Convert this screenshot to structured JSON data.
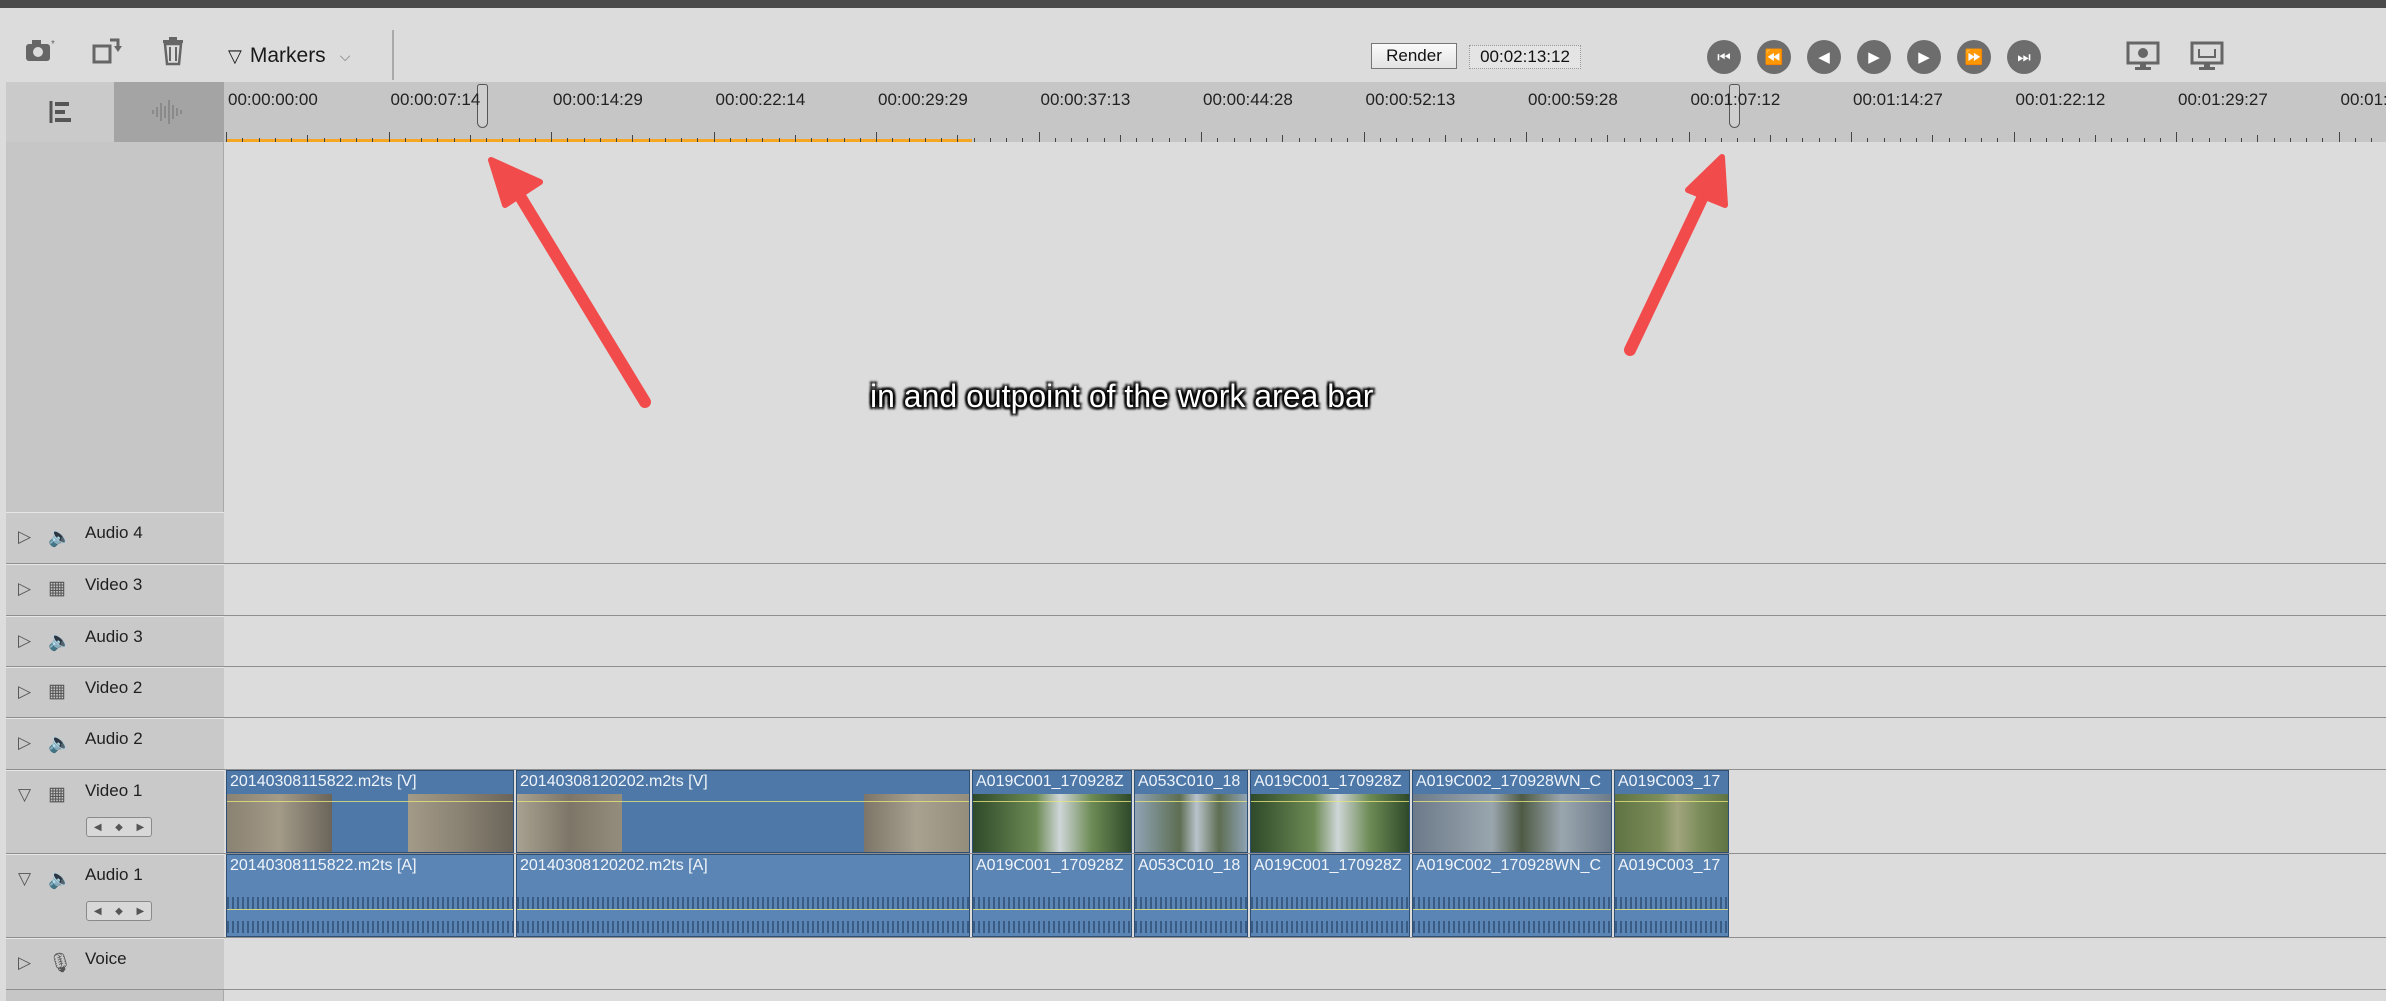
{
  "toolbar": {
    "markers_label": "Markers",
    "render_label": "Render",
    "timecode": "00:02:13:12",
    "icons": [
      "camera-icon",
      "rotate-icon",
      "trash-icon",
      "rewind-to-start-icon",
      "previous-edit-icon",
      "step-back-icon",
      "play-icon",
      "step-forward-icon",
      "next-edit-icon",
      "forward-to-end-icon",
      "render-settings-icon",
      "fullscreen-icon"
    ]
  },
  "ruler": {
    "labels": [
      "00:00:00:00",
      "00:00:07:14",
      "00:00:14:29",
      "00:00:22:14",
      "00:00:29:29",
      "00:00:37:13",
      "00:00:44:28",
      "00:00:52:13",
      "00:00:59:28",
      "00:01:07:12",
      "00:01:14:27",
      "00:01:22:12",
      "00:01:29:27",
      "00:01:"
    ],
    "work_area_color": "#f5a623"
  },
  "annotation": "in and outpoint of the work area bar",
  "tracks": [
    {
      "name": "Audio 4",
      "type": "audio"
    },
    {
      "name": "Video 3",
      "type": "video"
    },
    {
      "name": "Audio 3",
      "type": "audio"
    },
    {
      "name": "Video 2",
      "type": "video"
    },
    {
      "name": "Audio 2",
      "type": "audio"
    },
    {
      "name": "Video 1",
      "type": "video"
    },
    {
      "name": "Audio 1",
      "type": "audio"
    },
    {
      "name": "Voice",
      "type": "voice"
    }
  ],
  "video1_clips": [
    "20140308115822.m2ts [V]",
    "20140308120202.m2ts [V]",
    "A019C001_170928Z",
    "A053C010_18",
    "A019C001_170928Z",
    "A019C002_170928WN_C",
    "A019C003_17"
  ],
  "audio1_clips": [
    "20140308115822.m2ts [A]",
    "20140308120202.m2ts [A]",
    "A019C001_170928Z",
    "A053C010_18",
    "A019C001_170928Z",
    "A019C002_170928WN_C",
    "A019C003_17"
  ],
  "colors": {
    "clip": "#4d78a7",
    "arrow": "#f24b4b",
    "toolbar": "#dcdcdc"
  }
}
